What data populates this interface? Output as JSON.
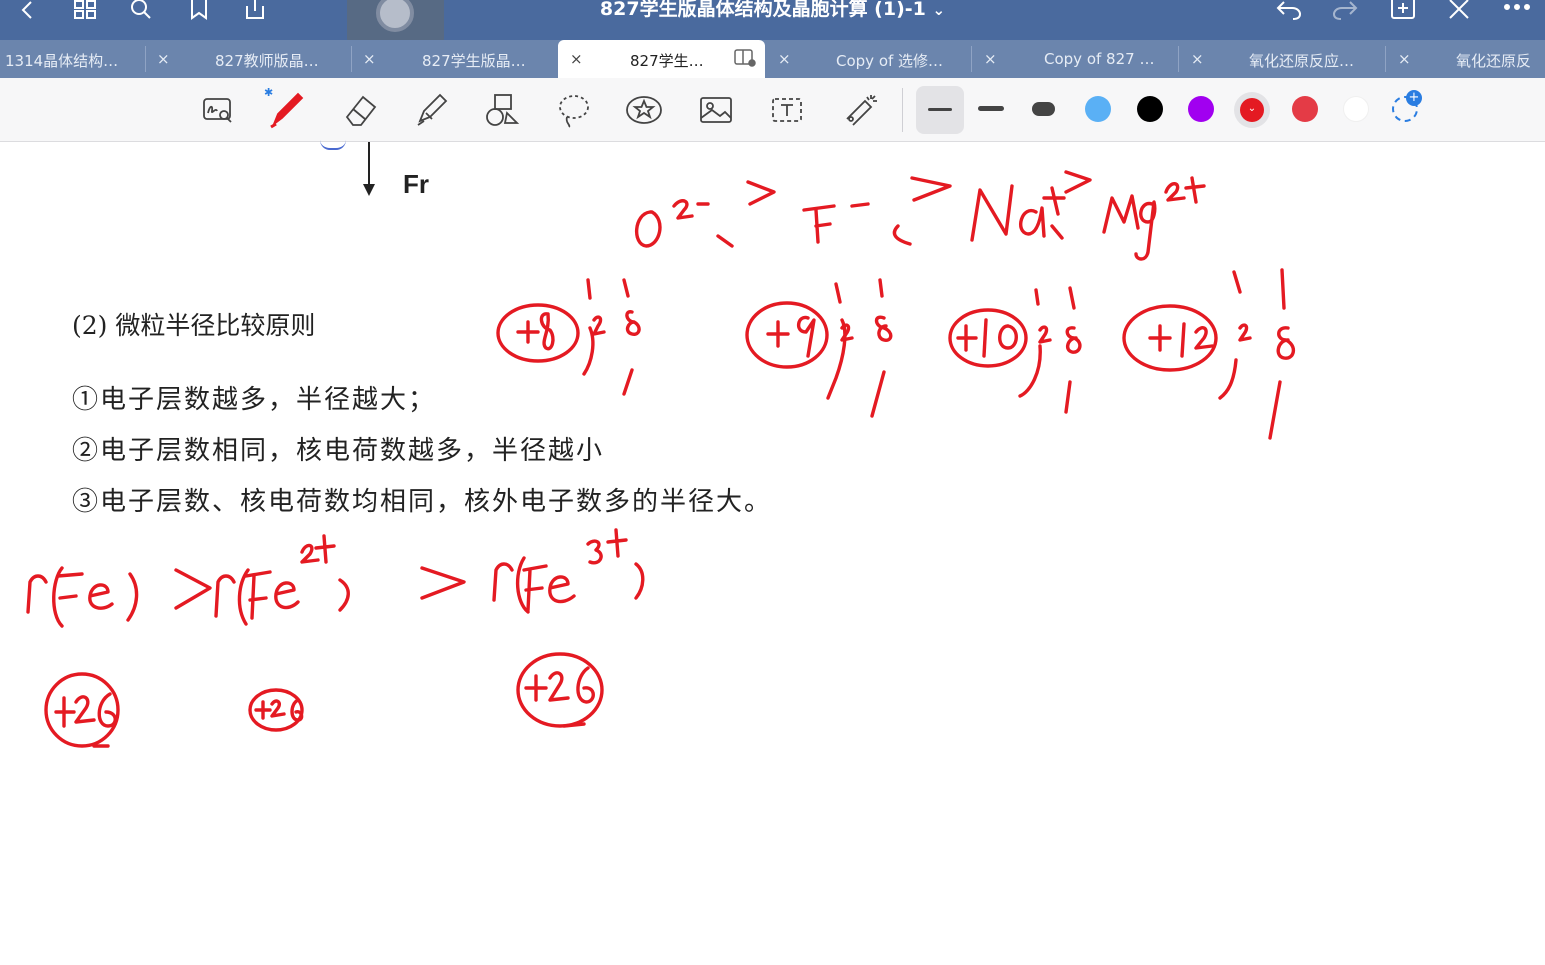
{
  "window": {
    "title": "827学生版晶体结构及晶胞计算 (1)-1",
    "title_chevron": "⌄"
  },
  "icons": {
    "back": "chevron-left-icon",
    "grid": "grid-icon",
    "search": "search-icon",
    "bookmark": "bookmark-icon",
    "share": "share-icon",
    "undo": "undo-icon",
    "redo": "redo-icon",
    "add_page": "add-page-icon",
    "close": "close-icon",
    "more": "more-icon"
  },
  "tabs": [
    {
      "label": "1314晶体结构…",
      "active": false,
      "close": "×"
    },
    {
      "label": "827教师版晶…",
      "active": false,
      "close": "×"
    },
    {
      "label": "827学生版晶…",
      "active": false,
      "close": "×"
    },
    {
      "label": "827学生…",
      "active": true,
      "close": "×"
    },
    {
      "label": "Copy of 选修…",
      "active": false,
      "close": "×"
    },
    {
      "label": "Copy of 827 …",
      "active": false,
      "close": "×"
    },
    {
      "label": "氧化还原反应…",
      "active": false,
      "close": "×"
    },
    {
      "label": "氧化还原反",
      "active": false,
      "close": "×"
    }
  ],
  "toolbar": {
    "tools": [
      "zoom-handwriting-icon",
      "pen-icon",
      "eraser-icon",
      "highlighter-icon",
      "shapes-icon",
      "lasso-icon",
      "sticker-icon",
      "image-icon",
      "text-icon",
      "laser-pointer-icon"
    ],
    "bluetooth_badge": "bluetooth-icon",
    "stroke_widths": [
      "thin",
      "medium",
      "thick"
    ],
    "selected_stroke": "thin",
    "colors": [
      "#5ab0f5",
      "#000000",
      "#a100f0",
      "#e41a22",
      "#e43b46",
      "#ffffff"
    ],
    "selected_color": "#e41a22"
  },
  "document": {
    "fr_label": "Fr",
    "section_heading": "(2)  微粒半径比较原则",
    "rules": [
      "①电子层数越多，半径越大；",
      "②电子层数相同，核电荷数越多，半径越小",
      "③电子层数、核电荷数均相同，核外电子数多的半径大。"
    ]
  },
  "colors": {
    "titlebar": "#4a6a9e",
    "tabstrip": "#6b85ad",
    "ink": "#e41a22",
    "toolbar": "#f7f7f8"
  }
}
